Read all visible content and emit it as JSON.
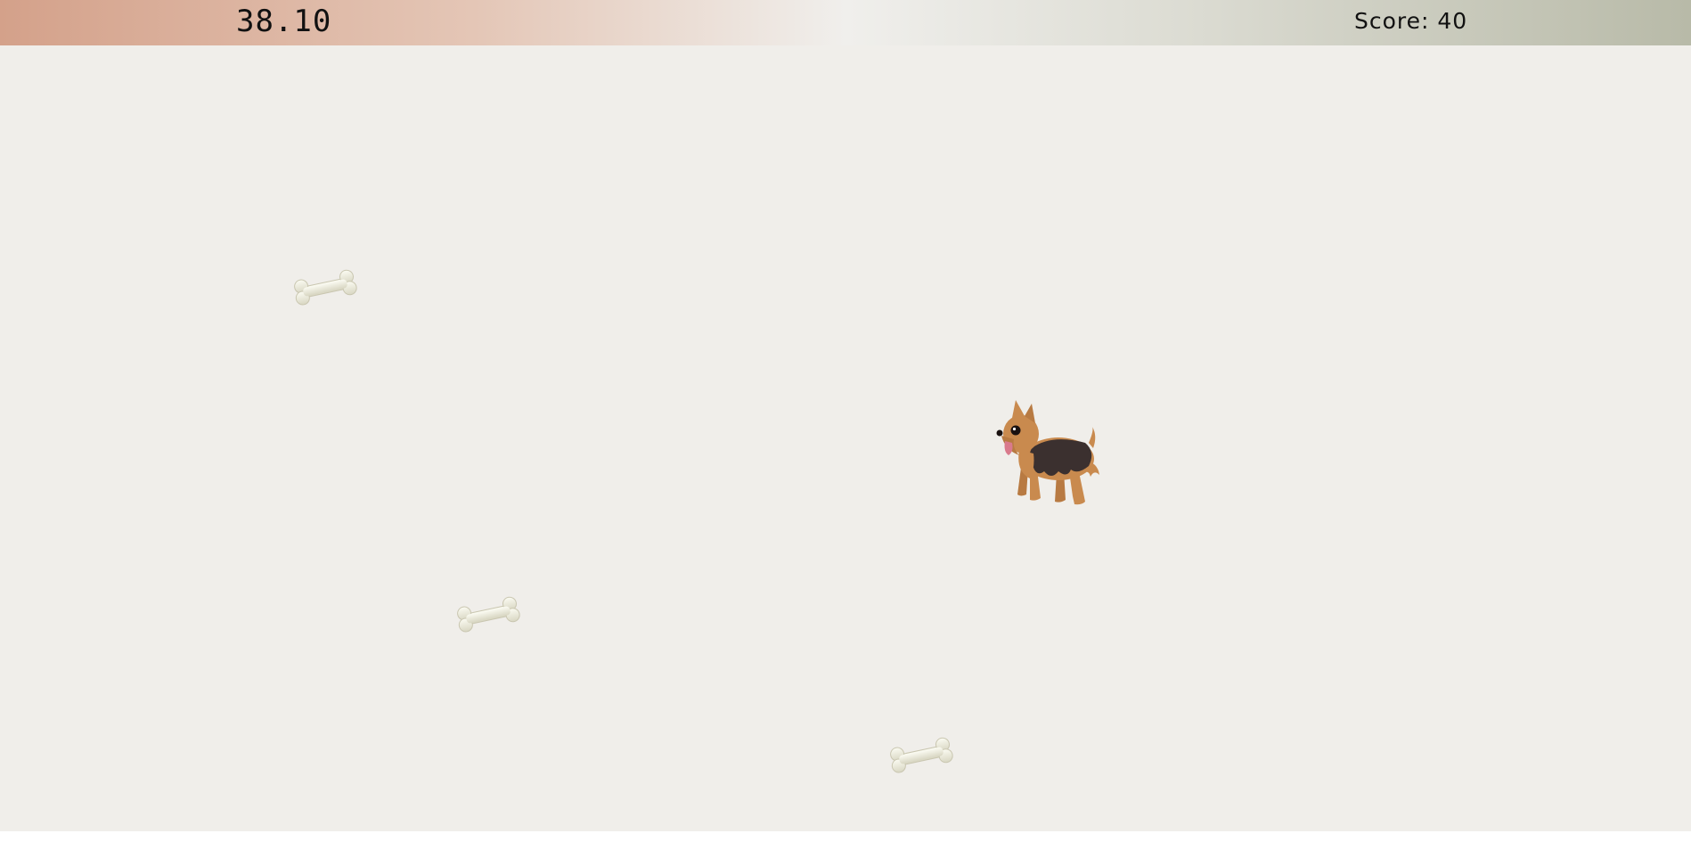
{
  "hud": {
    "timer": "38.10",
    "score_label": "Score: 40"
  },
  "game": {
    "player": "yorkshire-terrier-dog",
    "collectibles": [
      "bone",
      "bone",
      "bone"
    ]
  },
  "colors": {
    "background": "#f0eeea",
    "hud_left": "#d4a18a",
    "hud_center": "#f0efec",
    "hud_right": "#b8baa8"
  }
}
